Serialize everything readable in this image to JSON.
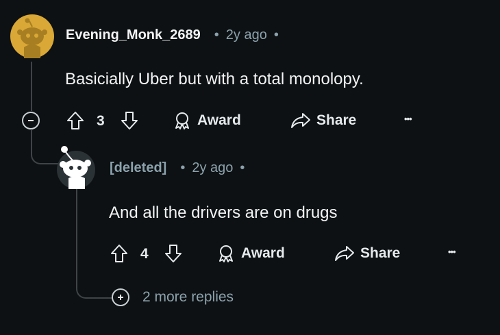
{
  "comment": {
    "author": "Evening_Monk_2689",
    "separator": "•",
    "time": "2y ago",
    "body": "Basicially Uber but with a total monolopy.",
    "votes": "3",
    "award_label": "Award",
    "share_label": "Share",
    "more_label": "•••",
    "collapse_label": "−",
    "avatar_color": "#d9a836"
  },
  "reply": {
    "author": "[deleted]",
    "separator": "•",
    "time": "2y ago",
    "body": "And all the drivers are on drugs",
    "votes": "4",
    "award_label": "Award",
    "share_label": "Share",
    "more_label": "•••",
    "expand_label": "+",
    "more_replies": "2 more replies"
  }
}
